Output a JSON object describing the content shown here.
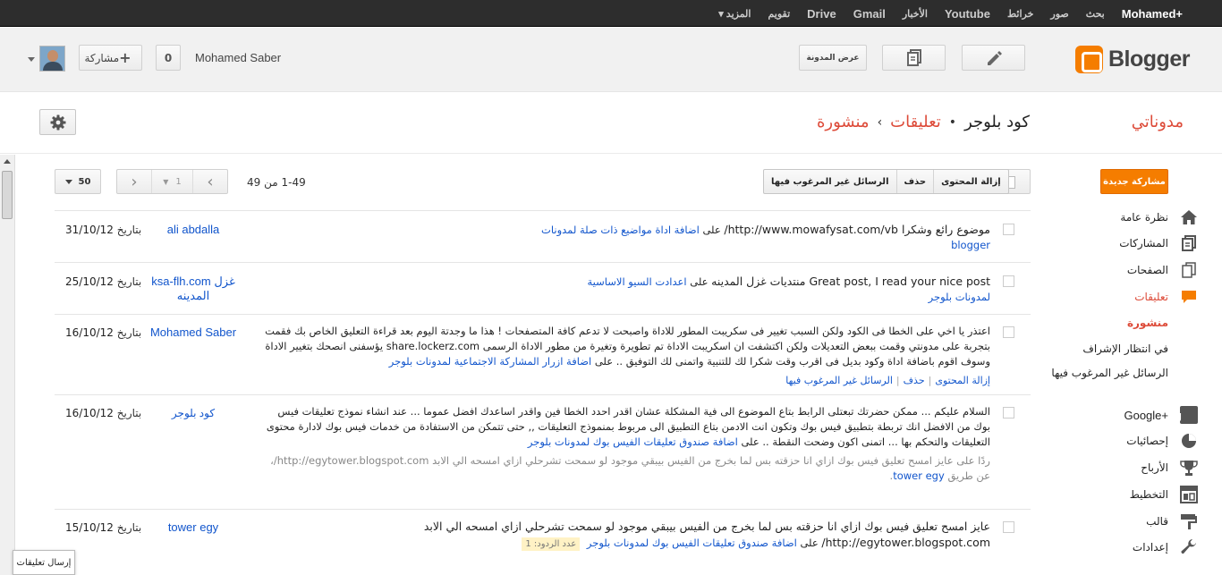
{
  "gbar": {
    "links": [
      "+Mohamed",
      "بحث",
      "صور",
      "خرائط",
      "Youtube",
      "الأخبار",
      "Gmail",
      "Drive",
      "تقويم",
      "المزيد ▾"
    ]
  },
  "header": {
    "logo_text": "Blogger",
    "view_blog_label": "عرض المدونة",
    "share_count": "0",
    "user_name": "Mohamed Saber",
    "share_label": "مشاركة"
  },
  "title_row": {
    "my_blogs": "مدوناتي",
    "blog_name": "كود بلوجر",
    "dot": "•",
    "section": "تعليقات",
    "arrow": "›",
    "subsection": "منشورة"
  },
  "sidebar": {
    "new_post": "مشاركة جديدة",
    "items": [
      {
        "label": "نظرة عامة",
        "icon": "home-icon"
      },
      {
        "label": "المشاركات",
        "icon": "posts-icon"
      },
      {
        "label": "الصفحات",
        "icon": "pages-icon"
      },
      {
        "label": "تعليقات",
        "icon": "comments-icon"
      },
      {
        "label": "+Google",
        "icon": "google-plus-icon"
      },
      {
        "label": "إحصائيات",
        "icon": "stats-icon"
      },
      {
        "label": "الأرباح",
        "icon": "trophy-icon"
      },
      {
        "label": "التخطيط",
        "icon": "layout-icon"
      },
      {
        "label": "قالب",
        "icon": "template-icon"
      },
      {
        "label": "إعدادات",
        "icon": "wrench-icon"
      }
    ],
    "sub": [
      "منشورة",
      "في انتظار الإشراف",
      "الرسائل غير المرغوب فيها"
    ]
  },
  "toolbar": {
    "remove_content": "إزالة المحتوى",
    "delete": "حذف",
    "spam": "الرسائل غير المرغوب فيها",
    "range": "1-49 من 49",
    "page": "1",
    "per_page": "50"
  },
  "comments": [
    {
      "date": "31/10/12",
      "date_prefix": "بتاريخ",
      "author": "ali abdalla",
      "text": "موضوع رائع وشكرا http://www.mowafysat.com/vb/",
      "on": "على",
      "post_link": "اضافة اداة مواضيع ذات صلة لمدونات blogger"
    },
    {
      "date": "25/10/12",
      "date_prefix": "بتاريخ",
      "author": "ksa-flh.com غزل المدينه",
      "text": "Great post, I read your nice post منتديات غزل المدينه",
      "on": "على",
      "post_link": "اعدادت السيو الاساسية لمدونات بلوجر"
    },
    {
      "date": "16/10/12",
      "date_prefix": "بتاريخ",
      "author": "Mohamed Saber",
      "text": "اعتذر يا اخي على الخطا فى الكود ولكن السبب تغيير فى سكريبت المطور للاداة واصبحت لا تدعم كافة المتصفحات ! هذا ما وجدتة اليوم بعد قراءة التعليق الخاص بك فقمت بتجربة على مدونتي وقمت ببعض التعديلات ولكن اكتشفت ان اسكريبت الاداة تم تطويرة وتغيرة من مطور الاداة الرسمى share.lockerz.com يؤسفنى انصحك بتغيير الاداة وسوف اقوم باضافة اداة وكود بديل فى اقرب وقت شكرا لك للتنبية واتمنى لك التوفيق .. على",
      "post_link": "اضافة ازرار المشاركة الاجتماعية لمدونات بلوجر",
      "actions": [
        "إزالة المحتوى",
        "حذف",
        "الرسائل غير المرغوب فيها"
      ]
    },
    {
      "date": "16/10/12",
      "date_prefix": "بتاريخ",
      "author": "كود بلوجر",
      "text": "السلام عليكم ... ممكن حضرتك تبعتلى الرابط بتاع الموضوع الى فية المشكلة عشان اقدر احدد الخطا فين واقدر اساعدك افضل عموما ... عند انشاء نموذج تعليقات فيس بوك من الافضل انك تربطة بتطبيق فيس بوك وتكون انت الادمن بتاع التطبيق الى مربوط بمنموذج التعليقات ,, حتى تتمكن من الاستفادة من خدمات فيس بوك لادارة محتوى التعليقات والتحكم بها ... اتمنى اكون وضحت النقطة ..",
      "on": "على",
      "post_link": "اضافة صندوق تعليقات الفيس بوك لمدونات بلوجر",
      "reply_prefix": "ردًا على عايز امسح تعليق فيس بوك ازاي انا حزقته بس لما بخرج من الفيس بيبقي موجود لو سمحت تشرحلي ازاي امسحه الي الابد http://egytower.blogspot.com/، عن طريق",
      "reply_author": "tower egy"
    },
    {
      "date": "15/10/12",
      "date_prefix": "بتاريخ",
      "author": "tower egy",
      "text": "عايز امسح تعليق فيس بوك ازاي انا حزقته بس لما بخرج من الفيس بيبقي موجود لو سمحت تشرحلي ازاي امسحه الي الابد http://egytower.blogspot.com/",
      "on": "على",
      "post_link": "اضافة صندوق تعليقات الفيس بوك لمدونات بلوجر",
      "replies": "عدد الردود: 1"
    }
  ],
  "tooltip": "إرسال تعليقات",
  "colors": {
    "accent": "#dd4b39",
    "brand": "#f57d00",
    "link": "#1155cc"
  }
}
